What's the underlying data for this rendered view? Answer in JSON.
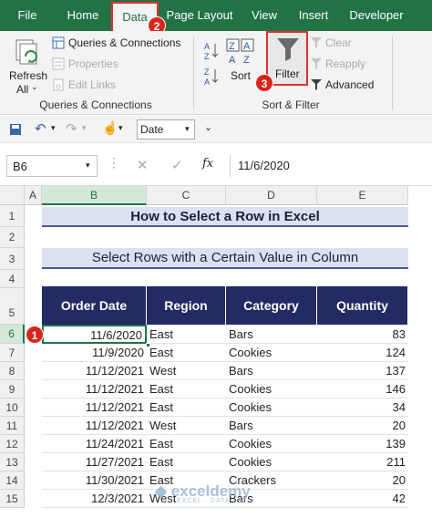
{
  "tabs": [
    "File",
    "Home",
    "Data",
    "Page Layout",
    "View",
    "Insert",
    "Developer"
  ],
  "ribbon": {
    "refresh_all_line1": "Refresh",
    "refresh_all_line2": "All",
    "queries_connections": "Queries & Connections",
    "properties": "Properties",
    "edit_links": "Edit Links",
    "group_queries": "Queries & Connections",
    "sort": "Sort",
    "filter": "Filter",
    "clear": "Clear",
    "reapply": "Reapply",
    "advanced": "Advanced",
    "group_sort_filter": "Sort & Filter"
  },
  "badges": [
    "1",
    "2",
    "3"
  ],
  "qat": {
    "number_format": "Date"
  },
  "formula_bar": {
    "name_box": "B6",
    "fx": "fx",
    "content": "11/6/2020"
  },
  "columns": [
    "A",
    "B",
    "C",
    "D",
    "E"
  ],
  "rows": [
    "1",
    "2",
    "3",
    "4",
    "5",
    "6",
    "7",
    "8",
    "9",
    "10",
    "11",
    "12",
    "13",
    "14",
    "15"
  ],
  "sheet": {
    "title": "How to Select a Row in Excel",
    "subtitle": "Select Rows with a Certain Value in Column",
    "headers": [
      "Order Date",
      "Region",
      "Category",
      "Quantity"
    ],
    "data": [
      [
        "11/6/2020",
        "East",
        "Bars",
        "83"
      ],
      [
        "11/9/2020",
        "East",
        "Cookies",
        "124"
      ],
      [
        "11/12/2021",
        "West",
        "Bars",
        "137"
      ],
      [
        "11/12/2021",
        "East",
        "Cookies",
        "146"
      ],
      [
        "11/12/2021",
        "East",
        "Cookies",
        "34"
      ],
      [
        "11/12/2021",
        "West",
        "Bars",
        "20"
      ],
      [
        "11/24/2021",
        "East",
        "Cookies",
        "139"
      ],
      [
        "11/27/2021",
        "East",
        "Cookies",
        "211"
      ],
      [
        "11/30/2021",
        "East",
        "Crackers",
        "20"
      ],
      [
        "12/3/2021",
        "West",
        "Bars",
        "42"
      ]
    ]
  },
  "watermark": {
    "name": "exceldemy",
    "tagline": "EXCEL · DATA · BI"
  }
}
